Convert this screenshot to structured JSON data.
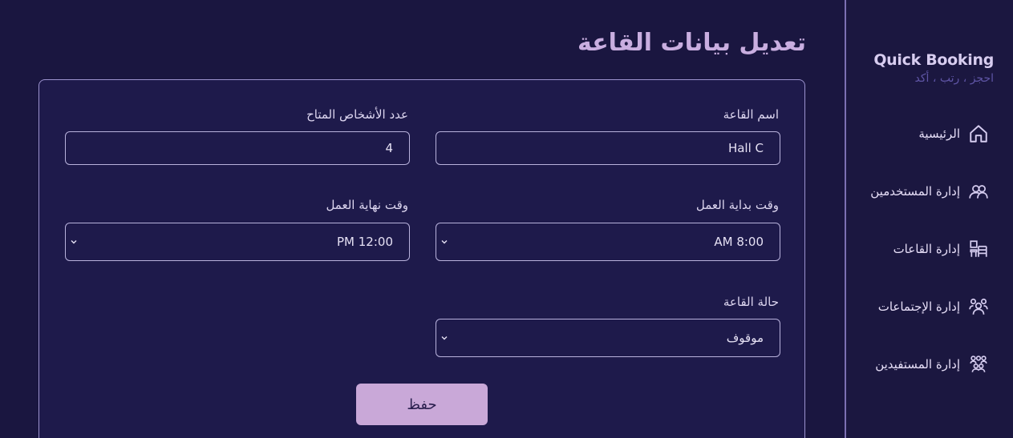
{
  "sidebar": {
    "brand_name": "Quick Booking",
    "brand_tagline": "احجز ، رتب ، أكد",
    "items": [
      {
        "label": "الرئيسية",
        "icon": "home-icon"
      },
      {
        "label": "إدارة المستخدمين",
        "icon": "users-icon"
      },
      {
        "label": "إدارة القاعات",
        "icon": "hall-icon"
      },
      {
        "label": "إدارة الإجتماعات",
        "icon": "meeting-icon"
      },
      {
        "label": "إدارة المستفيدين",
        "icon": "beneficiaries-icon"
      }
    ]
  },
  "page": {
    "title": "تعديل بيانات القاعة"
  },
  "form": {
    "hall_name": {
      "label": "اسم القاعة",
      "value": "Hall C"
    },
    "capacity": {
      "label": "عدد الأشخاص المتاح",
      "value": "4"
    },
    "start_time": {
      "label": "وقت بداية العمل",
      "value": "8:00 AM"
    },
    "end_time": {
      "label": "وقت نهاية العمل",
      "value": "12:00 PM"
    },
    "status": {
      "label": "حالة القاعة",
      "value": "موقوف"
    },
    "save_label": "حفظ"
  },
  "colors": {
    "background": "#1a1640",
    "card": "#1e1a4b",
    "accent": "#c9a8d8",
    "title": "#c9aee0",
    "tagline": "#5f55a6"
  }
}
